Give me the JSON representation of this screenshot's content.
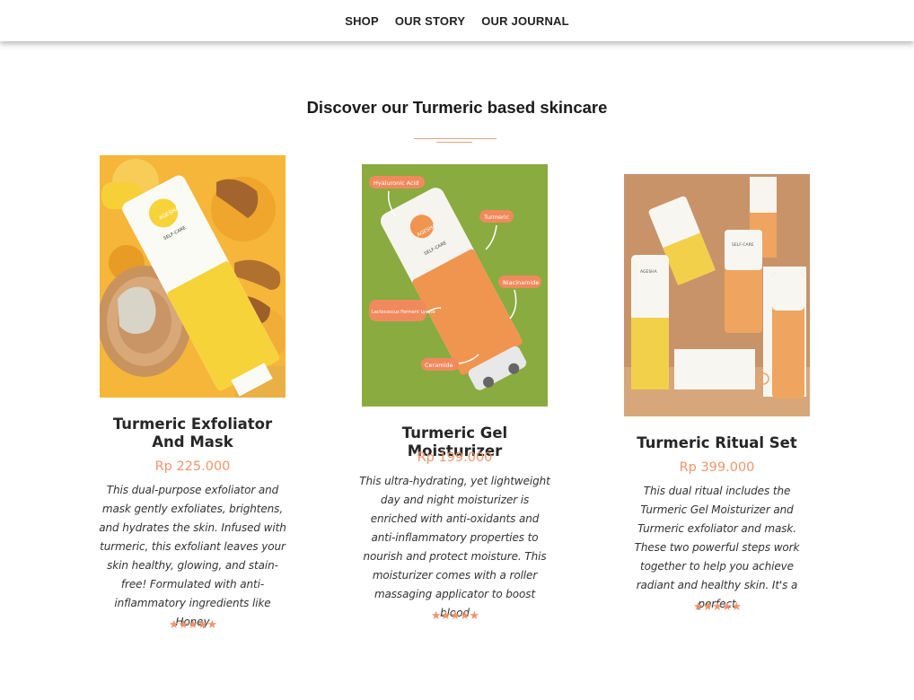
{
  "nav": {
    "items": [
      "SHOP",
      "OUR STORY",
      "OUR JOURNAL"
    ]
  },
  "section": {
    "heading": "Discover our Turmeric based skincare"
  },
  "products": [
    {
      "title": "Turmeric Exfoliator And Mask",
      "price": "Rp 225.000",
      "description": "This dual-purpose exfoliator and mask gently exfoliates, brightens, and hydrates the skin. Infused with turmeric, this exfoliant leaves your skin healthy, glowing, and stain-free! Formulated with anti-inflammatory ingredients like Honey",
      "rating": 5,
      "stars": "★★★★★",
      "image": {
        "brand_text": "AGESHA",
        "line_text": "SELF-CARE",
        "background": "#f5b63a"
      }
    },
    {
      "title": "Turmeric Gel Moisturizer",
      "price": "Rp 199.000",
      "description": "This ultra-hydrating, yet lightweight day and night moisturizer is enriched with anti-oxidants and anti-inflammatory properties to nourish and protect moisture. This moisturizer comes with a roller massaging applicator to boost blood",
      "rating": 5,
      "stars": "★★★★★",
      "image": {
        "brand_text": "AGESHA",
        "line_text": "SELF-CARE",
        "background": "#8aab3f",
        "labels": [
          "Hyaluronic Acid",
          "Turmeric",
          "Niacinamide",
          "Lactococcus Ferment Lysate",
          "Ceramide"
        ]
      }
    },
    {
      "title": "Turmeric Ritual Set",
      "price": "Rp 399.000",
      "description": "This dual ritual includes the Turmeric Gel Moisturizer and Turmeric exfoliator and mask. These two powerful steps work together to help you achieve radiant and healthy skin. It's a perfect",
      "rating": 5,
      "stars": "★★★★★",
      "image": {
        "brand_text": "AGESHA",
        "line_text": "SELF-CARE",
        "background": "#c9936a"
      }
    }
  ],
  "colors": {
    "accent": "#f0956a",
    "divider": "#e6a27d",
    "text": "#222222"
  }
}
